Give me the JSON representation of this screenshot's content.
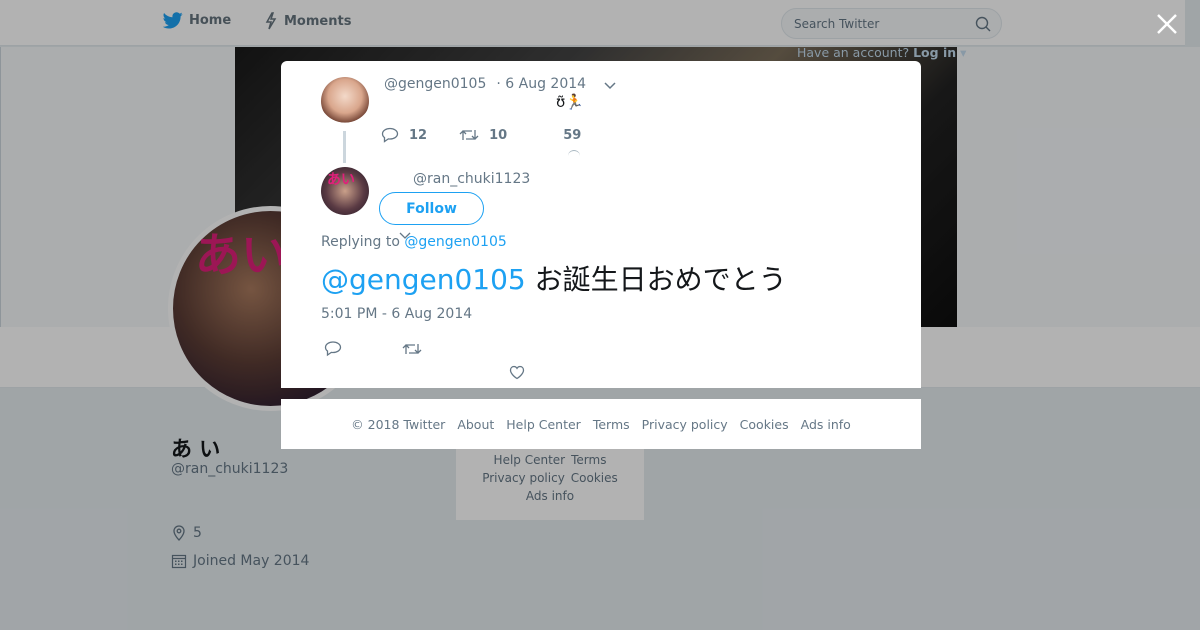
{
  "topbar": {
    "home_label": "Home",
    "moments_label": "Moments",
    "search_placeholder": "Search Twitter",
    "account_prompt": "Have an account?",
    "login_label": "Log in"
  },
  "profile": {
    "name": "あ い",
    "handle": "@ran_chuki1123",
    "location": "5",
    "joined": "Joined May 2014",
    "avatar_text": "あい"
  },
  "side_footer": {
    "row1": [
      "Help Center",
      "Terms"
    ],
    "row2": [
      "Privacy policy",
      "Cookies"
    ],
    "row3": [
      "Ads info"
    ]
  },
  "modal": {
    "quoted": {
      "handle": "@gengen0105",
      "date": "· 6 Aug 2014",
      "emoji_text": "ʊ̃🏃",
      "replies": "12",
      "retweets": "10",
      "likes": "59"
    },
    "tweet": {
      "handle": "@ran_chuki1123",
      "follow_label": "Follow",
      "replying_to_prefix": "Replying to",
      "replying_to_handle": "@gengen0105",
      "mention": "@gengen0105",
      "body": "お誕生日おめでとう",
      "timestamp": "5:01 PM - 6 Aug 2014",
      "avatar_text": "あい"
    }
  },
  "footer": {
    "copyright": "© 2018 Twitter",
    "links": [
      "About",
      "Help Center",
      "Terms",
      "Privacy policy",
      "Cookies",
      "Ads info"
    ]
  },
  "colors": {
    "accent": "#1da1f2",
    "muted": "#657786",
    "background": "#e6ecf0"
  }
}
